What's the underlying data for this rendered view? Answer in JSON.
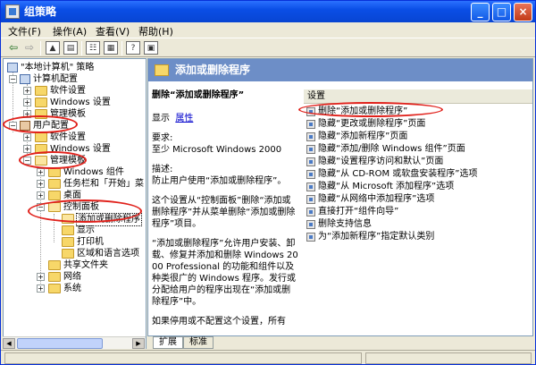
{
  "window": {
    "title": "组策略",
    "min": "_",
    "max": "□",
    "close": "×"
  },
  "menu": [
    "文件(F)",
    "操作(A)",
    "查看(V)",
    "帮助(H)"
  ],
  "tree": {
    "root": "\"本地计算机\" 策略",
    "computer_config": "计算机配置",
    "cc_items": [
      "软件设置",
      "Windows 设置",
      "管理模板"
    ],
    "user_config": "用户配置",
    "uc_items": [
      "软件设置",
      "Windows 设置",
      "管理模板"
    ],
    "at_items": [
      "Windows 组件",
      "任务栏和「开始」菜",
      "桌面",
      "控制面板"
    ],
    "cp_items": [
      "添加或删除程序",
      "显示",
      "打印机",
      "区域和语言选项"
    ],
    "at_tail": [
      "共享文件夹",
      "网络",
      "系统"
    ]
  },
  "right": {
    "header": "添加或删除程序",
    "desc": {
      "title": "删除“添加或删除程序”",
      "display_label": "显示",
      "display_link": "属性",
      "req_label": "要求:",
      "req_text": "至少 Microsoft Windows 2000",
      "desc_label": "描述:",
      "desc_text": "防止用户使用“添加或删除程序”。",
      "para1": "这个设置从“控制面板”删除“添加或删除程序”并从菜单删除“添加或删除程序”项目。",
      "para2": "“添加或删除程序”允许用户安装、卸载、修复并添加和删除 Windows 2000 Professional 的功能和组件以及种类很广的 Windows 程序。发行或分配给用户的程序出现在“添加或删除程序”中。",
      "para3": "如果停用或不配置这个设置，所有"
    },
    "list_header": "设置",
    "settings": [
      "删除“添加或删除程序”",
      "隐藏“更改或删除程序”页面",
      "隐藏“添加新程序”页面",
      "隐藏“添加/删除 Windows 组件”页面",
      "隐藏“设置程序访问和默认”页面",
      "隐藏“从 CD-ROM 或软盘安装程序”选项",
      "隐藏“从 Microsoft 添加程序”选项",
      "隐藏“从网络中添加程序”选项",
      "直接打开“组件向导”",
      "删除支持信息",
      "为“添加新程序”指定默认类别"
    ]
  },
  "tabs": [
    "扩展",
    "标准"
  ]
}
